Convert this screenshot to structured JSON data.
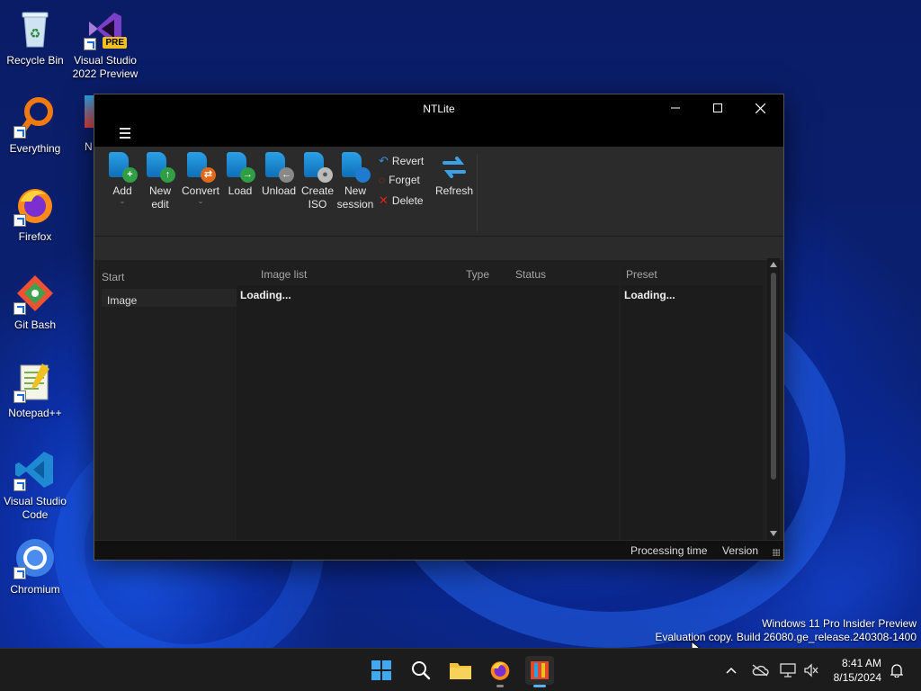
{
  "desktop": {
    "icons": [
      {
        "label": "Recycle Bin"
      },
      {
        "label": "Visual Studio 2022 Preview",
        "badge": "PRE"
      },
      {
        "label": "Everything"
      },
      {
        "label": "Firefox"
      },
      {
        "label": "Git Bash"
      },
      {
        "label": "Notepad++"
      },
      {
        "label": "Visual Studio Code"
      },
      {
        "label": "Chromium"
      }
    ],
    "partial_label": "N"
  },
  "window": {
    "title": "NTLite",
    "ribbon": {
      "add": "Add",
      "new_edit": "New edit",
      "convert": "Convert",
      "load": "Load",
      "unload": "Unload",
      "create_iso": "Create ISO",
      "new_session": "New session",
      "revert": "Revert",
      "forget": "Forget",
      "delete": "Delete",
      "refresh": "Refresh"
    },
    "start_pane": {
      "header": "Start",
      "items": [
        "Image"
      ]
    },
    "image_list": {
      "columns": [
        "Image list",
        "Type",
        "Status"
      ],
      "loading": "Loading..."
    },
    "preset_pane": {
      "header": "Preset",
      "loading": "Loading..."
    },
    "statusbar": {
      "processing_time": "Processing time",
      "version": "Version"
    }
  },
  "watermark": {
    "line1": "Windows 11 Pro Insider Preview",
    "line2": "Evaluation copy. Build 26080.ge_release.240308-1400"
  },
  "taskbar": {
    "apps": [
      "start-icon",
      "search-icon",
      "file-explorer-icon",
      "firefox-icon",
      "ntlite-icon"
    ],
    "clock": {
      "time": "8:41 AM",
      "date": "8/15/2024"
    }
  },
  "colors": {
    "accent": "#2aa0e6",
    "window_bg": "#202020",
    "titlebar_bg": "#000000"
  }
}
